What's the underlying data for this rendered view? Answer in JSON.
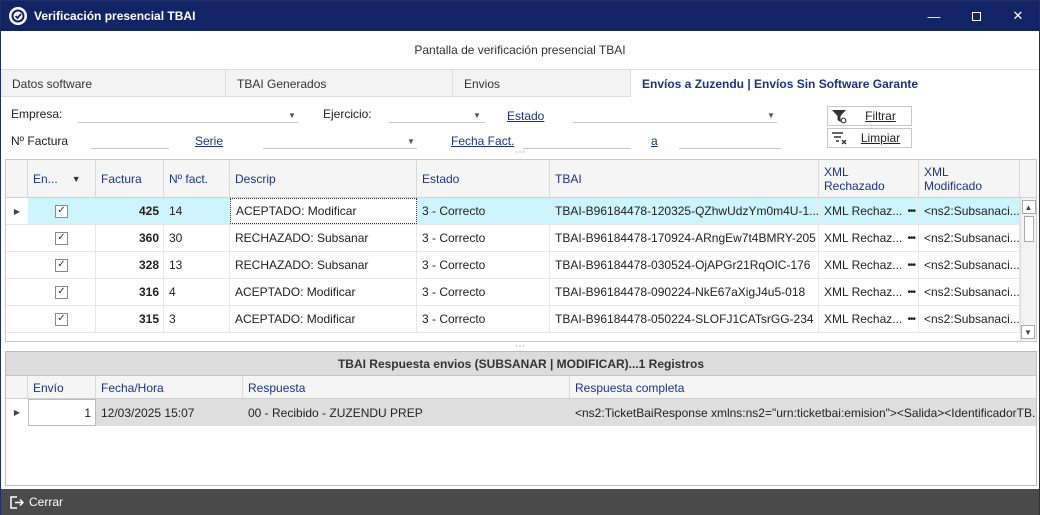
{
  "window": {
    "title": "Verificación presencial TBAI"
  },
  "subtitle": "Pantalla de verificación presencial TBAI",
  "tabs": [
    {
      "label": "Datos software"
    },
    {
      "label": "TBAI Generados"
    },
    {
      "label": "Envios"
    },
    {
      "label": "Envíos a Zuzendu | Envíos Sin Software Garante"
    }
  ],
  "filters": {
    "empresa_label": "Empresa:",
    "ejercicio_label": "Ejercicio:",
    "estado_label": "Estado",
    "nfactura_label": "Nº Factura",
    "serie_label": "Serie",
    "fecha_label": "Fecha Fact.",
    "a_label": "a",
    "filtrar_label": "Filtrar",
    "limpiar_label": "Limpiar"
  },
  "grid": {
    "columns": [
      "En...",
      "Factura",
      "Nº fact.",
      "Descrip",
      "Estado",
      "TBAI",
      "XML Rechazado",
      "XML Modificado"
    ],
    "rows": [
      {
        "factura": "425",
        "nfact": "14",
        "descrip": "ACEPTADO: Modificar",
        "estado": "3 - Correcto",
        "tbai": "TBAI-B96184478-120325-QZhwUdzYm0m4U-1...",
        "xml_rech": "XML Rechaz...",
        "xml_mod": "<ns2:Subsanaci..."
      },
      {
        "factura": "360",
        "nfact": "30",
        "descrip": "RECHAZADO: Subsanar",
        "estado": "3 - Correcto",
        "tbai": "TBAI-B96184478-170924-ARngEw7t4BMRY-205",
        "xml_rech": "XML Rechaz...",
        "xml_mod": "<ns2:Subsanaci..."
      },
      {
        "factura": "328",
        "nfact": "13",
        "descrip": "RECHAZADO: Subsanar",
        "estado": "3 - Correcto",
        "tbai": "TBAI-B96184478-030524-OjAPGr21RqOIC-176",
        "xml_rech": "XML Rechaz...",
        "xml_mod": "<ns2:Subsanaci..."
      },
      {
        "factura": "316",
        "nfact": "4",
        "descrip": "ACEPTADO: Modificar",
        "estado": "3 - Correcto",
        "tbai": "TBAI-B96184478-090224-NkE67aXigJ4u5-018",
        "xml_rech": "XML Rechaz...",
        "xml_mod": "<ns2:Subsanaci..."
      },
      {
        "factura": "315",
        "nfact": "3",
        "descrip": "ACEPTADO: Modificar",
        "estado": "3 - Correcto",
        "tbai": "TBAI-B96184478-050224-SLOFJ1CATsrGG-234",
        "xml_rech": "XML Rechaz...",
        "xml_mod": "<ns2:Subsanaci..."
      }
    ]
  },
  "panel": {
    "title": "TBAI Respuesta envios (SUBSANAR | MODIFICAR)...1 Registros",
    "columns": [
      "Envío",
      "Fecha/Hora",
      "Respuesta",
      "Respuesta completa"
    ],
    "rows": [
      {
        "envio": "1",
        "fecha": "12/03/2025 15:07",
        "respuesta": "00 - Recibido - ZUZENDU PREP",
        "completa": "<ns2:TicketBaiResponse xmlns:ns2=\"urn:ticketbai:emision\"><Salida><IdentificadorTB..."
      }
    ]
  },
  "footer": {
    "close_label": "Cerrar"
  },
  "colors": {
    "titlebar": "#132466",
    "accent": "#1e3480",
    "selected_row": "#cdf3fb",
    "footer": "#4a4a4a"
  }
}
